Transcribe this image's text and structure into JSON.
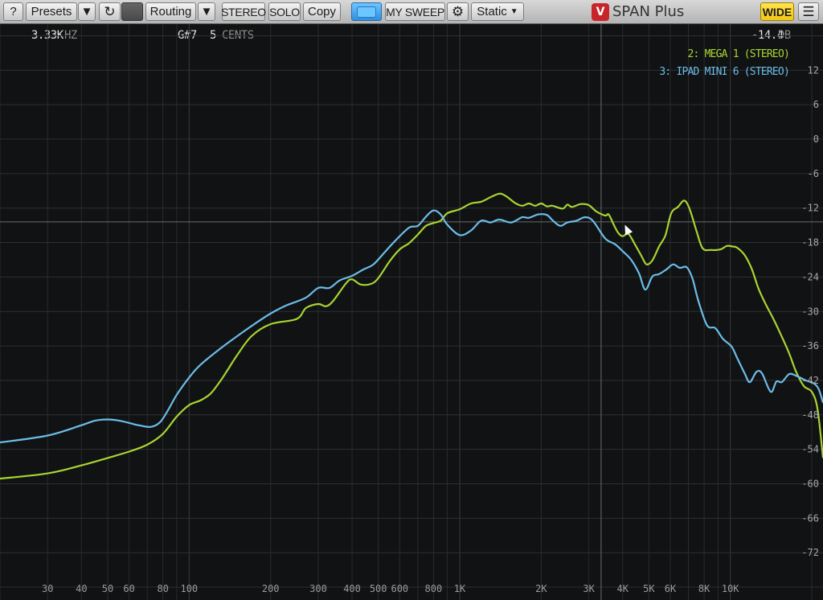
{
  "toolbar": {
    "help_label": "?",
    "presets_label": "Presets",
    "routing_label": "Routing",
    "stereo_label": "STEREO",
    "solo_label": "SOLO",
    "copy_label": "Copy",
    "sweep_label": "MY SWEEP",
    "static_label": "Static",
    "app_title": "SPAN Plus",
    "wide_label": "WIDE",
    "icons": [
      "undo-icon",
      "gear-icon",
      "menu-icon",
      "dropdown-arrow-icon",
      "span-logo-icon"
    ],
    "accent_colors": {
      "power": "#5bb8f5",
      "wide": "#f5d321"
    }
  },
  "readout": {
    "freq_value": "3.33K",
    "freq_unit": "HZ",
    "note_value": "G#7",
    "cents_value": "5",
    "cents_unit": "CENTS",
    "level_value": "-14.4",
    "level_unit": "DB"
  },
  "chart_data": {
    "type": "line",
    "x_scale": "log",
    "x_range": [
      20,
      22000
    ],
    "ylim": [
      -78,
      18
    ],
    "grid": true,
    "legend_position": "top-right",
    "xlabel": "",
    "ylabel": "",
    "x_tick_labels": [
      {
        "f": 30,
        "label": "30"
      },
      {
        "f": 40,
        "label": "40"
      },
      {
        "f": 50,
        "label": "50"
      },
      {
        "f": 60,
        "label": "60"
      },
      {
        "f": 80,
        "label": "80"
      },
      {
        "f": 100,
        "label": "100"
      },
      {
        "f": 200,
        "label": "200"
      },
      {
        "f": 300,
        "label": "300"
      },
      {
        "f": 400,
        "label": "400"
      },
      {
        "f": 500,
        "label": "500"
      },
      {
        "f": 600,
        "label": "600"
      },
      {
        "f": 800,
        "label": "800"
      },
      {
        "f": 1000,
        "label": "1K"
      },
      {
        "f": 2000,
        "label": "2K"
      },
      {
        "f": 3000,
        "label": "3K"
      },
      {
        "f": 4000,
        "label": "4K"
      },
      {
        "f": 5000,
        "label": "5K"
      },
      {
        "f": 6000,
        "label": "6K"
      },
      {
        "f": 8000,
        "label": "8K"
      },
      {
        "f": 10000,
        "label": "10K"
      }
    ],
    "y_ticks": [
      12,
      6,
      0,
      -6,
      -12,
      -18,
      -24,
      -30,
      -36,
      -42,
      -48,
      -54,
      -60,
      -66,
      -72
    ],
    "cursor": {
      "freq": 3330,
      "db": -14.4
    },
    "series": [
      {
        "name": "2: MEGA 1 (STEREO)",
        "color": "#a8d432",
        "points": [
          [
            20,
            -59.1
          ],
          [
            30,
            -58.2
          ],
          [
            40,
            -56.8
          ],
          [
            50,
            -55.5
          ],
          [
            60,
            -54.4
          ],
          [
            70,
            -53.2
          ],
          [
            80,
            -51.3
          ],
          [
            90,
            -48.3
          ],
          [
            100,
            -46.3
          ],
          [
            110,
            -45.5
          ],
          [
            120,
            -44.3
          ],
          [
            130,
            -42.2
          ],
          [
            140,
            -39.9
          ],
          [
            150,
            -37.7
          ],
          [
            170,
            -34.3
          ],
          [
            200,
            -32.2
          ],
          [
            250,
            -31.3
          ],
          [
            270,
            -29.4
          ],
          [
            300,
            -28.7
          ],
          [
            320,
            -29.1
          ],
          [
            340,
            -28.2
          ],
          [
            380,
            -25.1
          ],
          [
            400,
            -24.4
          ],
          [
            430,
            -25.3
          ],
          [
            470,
            -25.2
          ],
          [
            500,
            -24.2
          ],
          [
            550,
            -21.3
          ],
          [
            600,
            -19.2
          ],
          [
            650,
            -18.1
          ],
          [
            700,
            -16.6
          ],
          [
            750,
            -15.1
          ],
          [
            800,
            -14.6
          ],
          [
            850,
            -14.2
          ],
          [
            900,
            -12.9
          ],
          [
            1000,
            -12.2
          ],
          [
            1100,
            -11.2
          ],
          [
            1200,
            -10.9
          ],
          [
            1300,
            -10.1
          ],
          [
            1400,
            -9.5
          ],
          [
            1480,
            -9.9
          ],
          [
            1600,
            -11.1
          ],
          [
            1700,
            -11.6
          ],
          [
            1800,
            -11.2
          ],
          [
            1900,
            -11.6
          ],
          [
            2000,
            -11.2
          ],
          [
            2100,
            -11.7
          ],
          [
            2200,
            -11.6
          ],
          [
            2400,
            -12.1
          ],
          [
            2500,
            -11.4
          ],
          [
            2600,
            -11.8
          ],
          [
            2800,
            -11.3
          ],
          [
            3000,
            -11.5
          ],
          [
            3200,
            -12.6
          ],
          [
            3450,
            -13.3
          ],
          [
            3550,
            -13.1
          ],
          [
            3700,
            -14.8
          ],
          [
            3850,
            -16.3
          ],
          [
            4000,
            -16.9
          ],
          [
            4200,
            -16.5
          ],
          [
            4450,
            -18.4
          ],
          [
            4700,
            -20.4
          ],
          [
            4900,
            -21.8
          ],
          [
            5150,
            -21.1
          ],
          [
            5450,
            -18.7
          ],
          [
            5750,
            -16.8
          ],
          [
            6050,
            -12.9
          ],
          [
            6400,
            -11.8
          ],
          [
            6750,
            -10.7
          ],
          [
            7050,
            -12.0
          ],
          [
            7500,
            -16.0
          ],
          [
            7900,
            -19.0
          ],
          [
            8500,
            -19.3
          ],
          [
            9200,
            -19.2
          ],
          [
            9700,
            -18.6
          ],
          [
            10200,
            -18.7
          ],
          [
            10600,
            -18.9
          ],
          [
            11300,
            -20.2
          ],
          [
            12000,
            -22.6
          ],
          [
            12700,
            -26.0
          ],
          [
            13500,
            -28.7
          ],
          [
            14500,
            -31.5
          ],
          [
            15500,
            -34.4
          ],
          [
            16500,
            -37.3
          ],
          [
            17500,
            -40.5
          ],
          [
            18700,
            -43.0
          ],
          [
            20000,
            -44.0
          ],
          [
            21000,
            -47.0
          ],
          [
            22000,
            -55.5
          ]
        ]
      },
      {
        "name": "3: IPAD MINI 6 (STEREO)",
        "color": "#6bbde8",
        "points": [
          [
            20,
            -52.8
          ],
          [
            30,
            -51.6
          ],
          [
            40,
            -49.8
          ],
          [
            45,
            -49.0
          ],
          [
            50,
            -48.8
          ],
          [
            55,
            -49.0
          ],
          [
            60,
            -49.4
          ],
          [
            65,
            -49.8
          ],
          [
            72,
            -50.1
          ],
          [
            78,
            -49.3
          ],
          [
            84,
            -47.0
          ],
          [
            90,
            -44.5
          ],
          [
            100,
            -41.5
          ],
          [
            110,
            -39.3
          ],
          [
            130,
            -36.5
          ],
          [
            160,
            -33.4
          ],
          [
            190,
            -31.0
          ],
          [
            210,
            -29.8
          ],
          [
            230,
            -28.9
          ],
          [
            270,
            -27.6
          ],
          [
            300,
            -25.9
          ],
          [
            330,
            -25.9
          ],
          [
            360,
            -24.6
          ],
          [
            400,
            -23.8
          ],
          [
            440,
            -22.7
          ],
          [
            480,
            -21.8
          ],
          [
            530,
            -19.6
          ],
          [
            580,
            -17.6
          ],
          [
            650,
            -15.4
          ],
          [
            700,
            -15.1
          ],
          [
            750,
            -13.5
          ],
          [
            800,
            -12.4
          ],
          [
            850,
            -13.1
          ],
          [
            900,
            -14.9
          ],
          [
            1000,
            -16.7
          ],
          [
            1100,
            -15.9
          ],
          [
            1200,
            -14.2
          ],
          [
            1300,
            -14.5
          ],
          [
            1400,
            -14.0
          ],
          [
            1550,
            -14.5
          ],
          [
            1700,
            -13.6
          ],
          [
            1800,
            -13.7
          ],
          [
            1950,
            -13.1
          ],
          [
            2100,
            -13.2
          ],
          [
            2200,
            -14.1
          ],
          [
            2350,
            -15.1
          ],
          [
            2500,
            -14.5
          ],
          [
            2700,
            -14.2
          ],
          [
            2900,
            -13.6
          ],
          [
            3100,
            -14.2
          ],
          [
            3450,
            -17.3
          ],
          [
            3750,
            -18.3
          ],
          [
            4000,
            -19.5
          ],
          [
            4300,
            -21.0
          ],
          [
            4600,
            -23.4
          ],
          [
            4850,
            -26.2
          ],
          [
            5150,
            -23.9
          ],
          [
            5450,
            -23.5
          ],
          [
            5800,
            -22.7
          ],
          [
            6150,
            -21.8
          ],
          [
            6500,
            -22.4
          ],
          [
            6900,
            -22.3
          ],
          [
            7250,
            -24.3
          ],
          [
            7600,
            -28.0
          ],
          [
            8200,
            -32.4
          ],
          [
            8800,
            -32.9
          ],
          [
            9400,
            -34.8
          ],
          [
            10100,
            -36.1
          ],
          [
            10600,
            -38.1
          ],
          [
            11300,
            -40.8
          ],
          [
            11800,
            -42.3
          ],
          [
            12500,
            -40.5
          ],
          [
            13100,
            -40.8
          ],
          [
            14100,
            -44.0
          ],
          [
            14800,
            -42.2
          ],
          [
            15500,
            -42.3
          ],
          [
            16500,
            -40.9
          ],
          [
            17500,
            -41.2
          ],
          [
            19000,
            -42.0
          ],
          [
            20300,
            -42.5
          ],
          [
            21200,
            -43.5
          ],
          [
            22000,
            -45.9
          ]
        ]
      }
    ]
  }
}
